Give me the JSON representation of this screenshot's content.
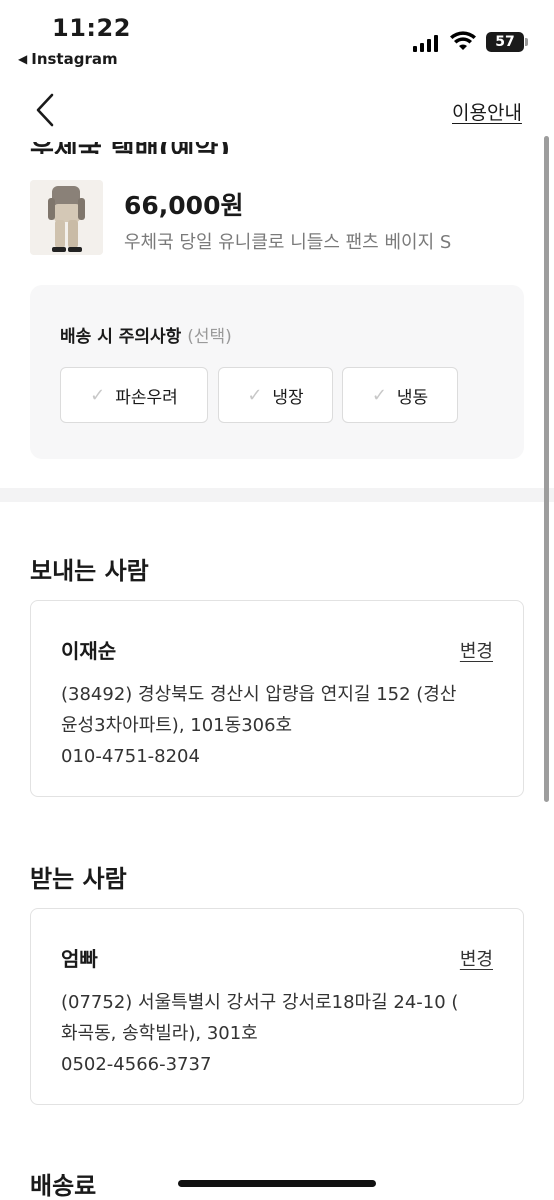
{
  "status_bar": {
    "time": "11:22",
    "back_app": "Instagram",
    "battery": "57"
  },
  "nav": {
    "guide_link": "이용안내"
  },
  "partial_title": "우체국 택배(예약)",
  "product": {
    "price": "66,000원",
    "name": "우체국 당일 유니클로 니들스 팬츠 베이지 S"
  },
  "caution": {
    "title": "배송 시 주의사항",
    "optional": "(선택)",
    "options": [
      "파손우려",
      "냉장",
      "냉동"
    ]
  },
  "sender": {
    "section_title": "보내는 사람",
    "name": "이재순",
    "change_label": "변경",
    "address_line1": "(38492) 경상북도 경산시 압량읍 연지길 152 (경산",
    "address_line2": "윤성3차아파트), 101동306호",
    "phone": "010-4751-8204"
  },
  "receiver": {
    "section_title": "받는 사람",
    "name": "엄빠",
    "change_label": "변경",
    "address_line1": "(07752) 서울특별시 강서구 강서로18마길 24-10 (",
    "address_line2": "화곡동, 송학빌라), 301호",
    "phone": "0502-4566-3737"
  },
  "shipping_fee": {
    "section_title": "배송료"
  }
}
